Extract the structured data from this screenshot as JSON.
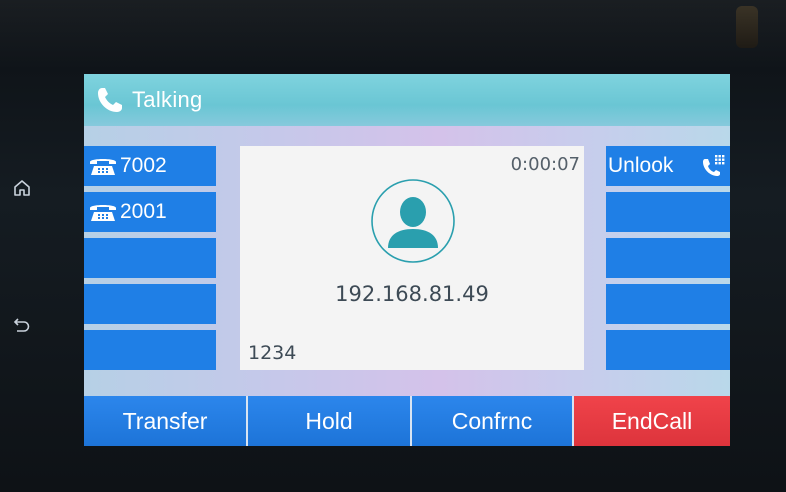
{
  "status": {
    "label": "Talking",
    "icon": "handset-icon"
  },
  "line_keys": [
    {
      "label": "7002",
      "icon": "desk-phone-icon"
    },
    {
      "label": "2001",
      "icon": "desk-phone-icon"
    },
    {
      "label": ""
    },
    {
      "label": ""
    },
    {
      "label": ""
    }
  ],
  "call": {
    "timer": "0:00:07",
    "caller": "192.168.81.49",
    "dialed": "1234",
    "avatar_icon": "contact-avatar-icon"
  },
  "right_keys": [
    {
      "label": "Unlook",
      "icon": "dialpad-phone-icon"
    },
    {
      "label": ""
    },
    {
      "label": ""
    },
    {
      "label": ""
    },
    {
      "label": ""
    }
  ],
  "softkeys": [
    "Transfer",
    "Hold",
    "Confrnc",
    "EndCall"
  ],
  "hardware": {
    "home_icon": "home-icon",
    "back_icon": "back-icon"
  },
  "colors": {
    "status_bar": "#6ac6d4",
    "key_blue": "#1f7fe6",
    "endcall_red": "#dd343c",
    "panel": "#f4f4f4"
  }
}
